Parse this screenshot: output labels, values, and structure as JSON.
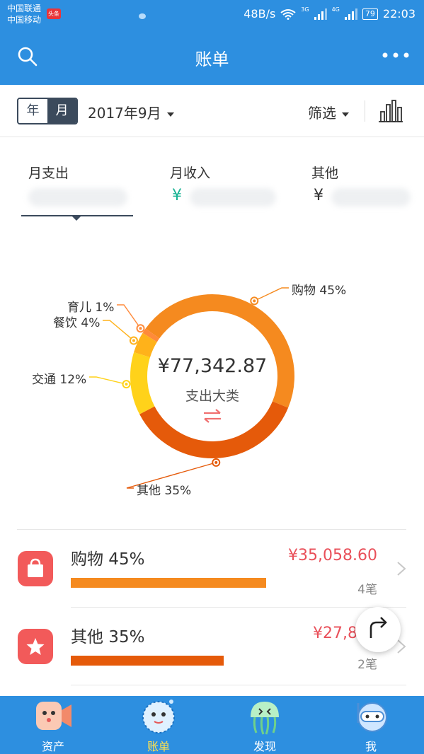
{
  "status_bar": {
    "carrier1": "中国联通",
    "carrier2": "中国移动",
    "badge": "头条",
    "net_speed": "48B/s",
    "net1": "3G",
    "net2": "4G",
    "battery": "79",
    "time": "22:03"
  },
  "header": {
    "title": "账单",
    "search_icon": "search-icon",
    "more_icon": "more-icon"
  },
  "filter_bar": {
    "year_label": "年",
    "month_label": "月",
    "selected_period": "2017年9月",
    "filter_label": "筛选",
    "chart_icon": "bar-chart-icon"
  },
  "summary_tabs": [
    {
      "label": "月支出",
      "currency": ""
    },
    {
      "label": "月收入",
      "currency": "¥"
    },
    {
      "label": "其他",
      "currency": "¥"
    }
  ],
  "donut": {
    "total": "¥77,342.87",
    "subtitle": "支出大类",
    "segments": [
      {
        "label": "购物 45%",
        "percent": 45,
        "color": "#f58a1f"
      },
      {
        "label": "其他 35%",
        "percent": 35,
        "color": "#e55a0a"
      },
      {
        "label": "交通 12%",
        "percent": 12,
        "color": "#ffd21a"
      },
      {
        "label": "餐饮 4%",
        "percent": 4,
        "color": "#ffb21a"
      },
      {
        "label": "育儿 1%",
        "percent": 1,
        "color": "#ff8a3a"
      }
    ]
  },
  "categories": [
    {
      "name": "购物 45%",
      "amount": "¥35,058.60",
      "count": "4笔",
      "bar_fraction": 0.46,
      "color": "#f58a1f",
      "icon": "shopping-bag-icon"
    },
    {
      "name": "其他 35%",
      "amount": "¥27,825",
      "count": "2笔",
      "bar_fraction": 0.36,
      "color": "#e55a0a",
      "icon": "star-icon"
    }
  ],
  "floating_button_icon": "redo-icon",
  "bottom_tabs": [
    {
      "label": "资产",
      "icon": "fish-mascot-icon"
    },
    {
      "label": "账单",
      "icon": "bubble-mascot-icon"
    },
    {
      "label": "发现",
      "icon": "jellyfish-mascot-icon"
    },
    {
      "label": "我",
      "icon": "diver-mascot-icon"
    }
  ]
}
